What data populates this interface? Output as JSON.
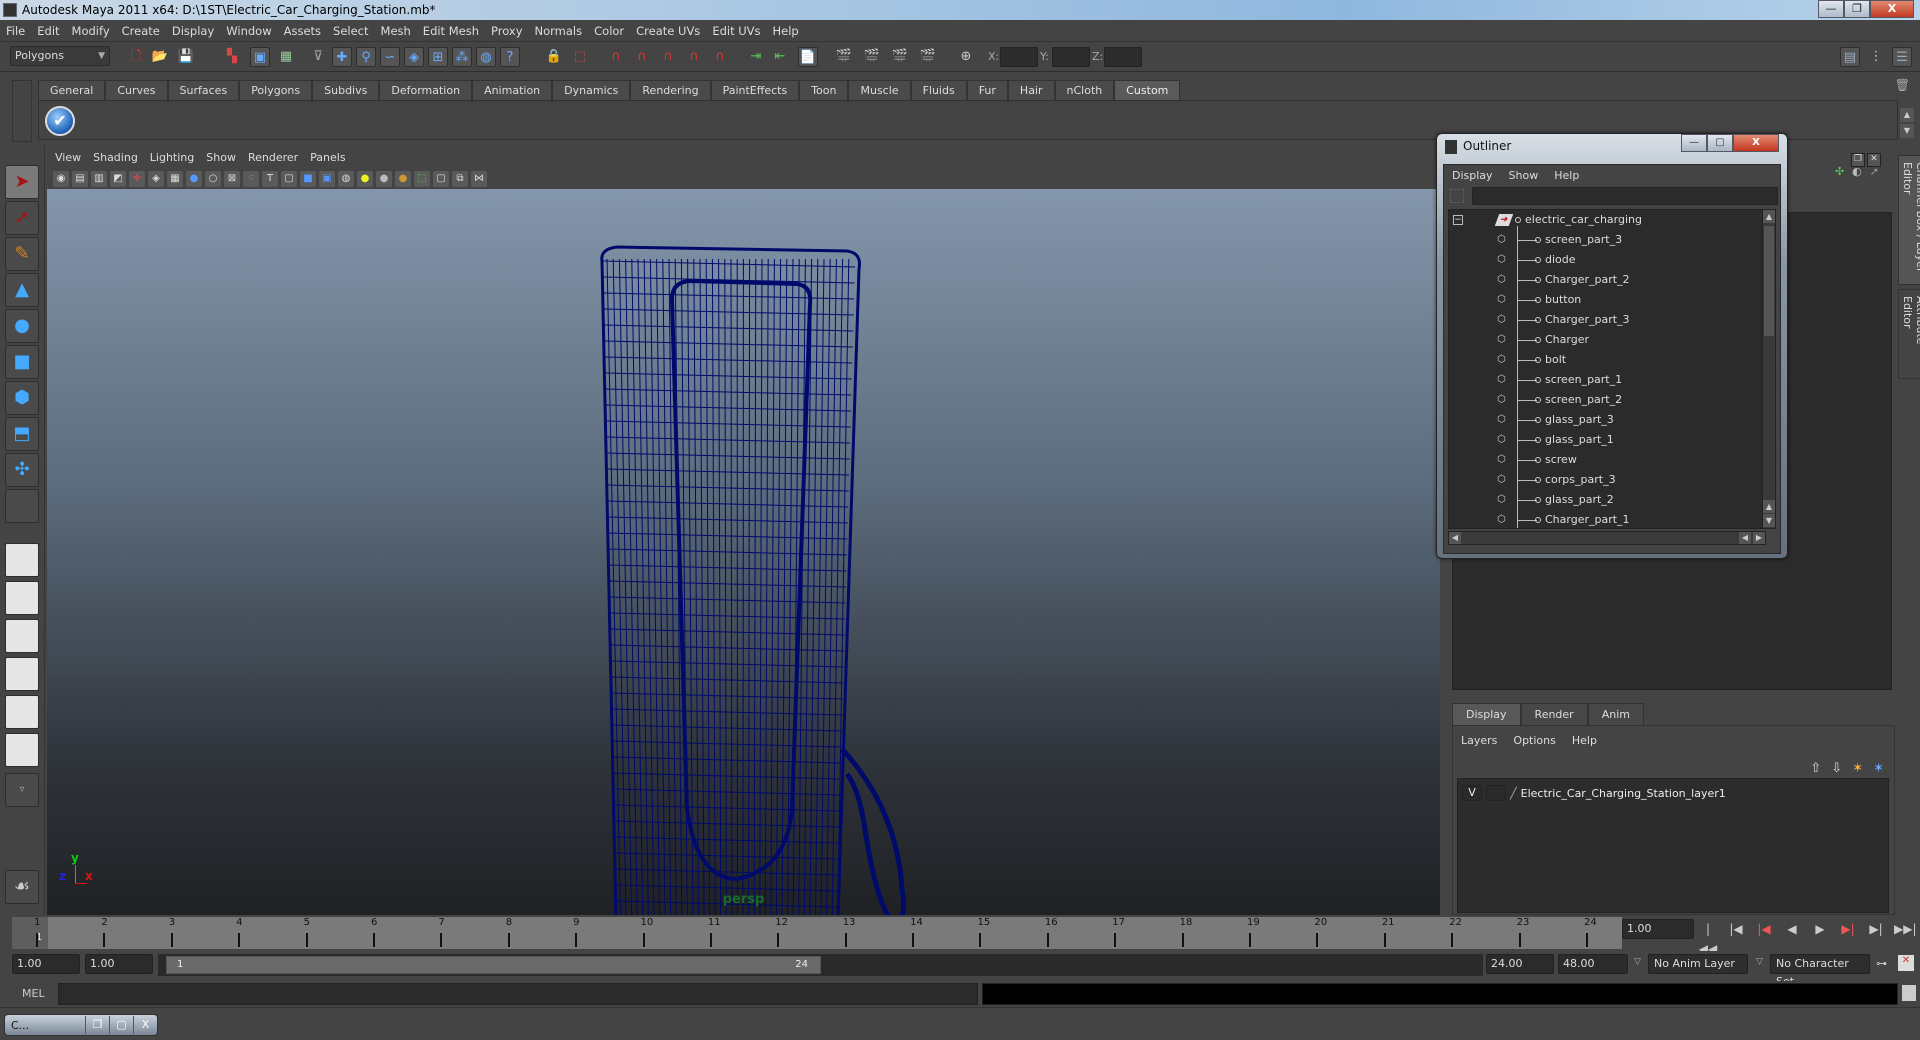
{
  "window": {
    "title": "Autodesk Maya 2011 x64: D:\\1ST\\Electric_Car_Charging_Station.mb*",
    "minimize": "—",
    "restore": "❐",
    "close": "X"
  },
  "menubar": [
    "File",
    "Edit",
    "Modify",
    "Create",
    "Display",
    "Window",
    "Assets",
    "Select",
    "Mesh",
    "Edit Mesh",
    "Proxy",
    "Normals",
    "Color",
    "Create UVs",
    "Edit UVs",
    "Help"
  ],
  "statusline": {
    "mode": "Polygons",
    "x_label": "X:",
    "y_label": "Y:",
    "z_label": "Z:",
    "x_value": "",
    "y_value": "",
    "z_value": ""
  },
  "shelf": {
    "tabs": [
      "General",
      "Curves",
      "Surfaces",
      "Polygons",
      "Subdivs",
      "Deformation",
      "Animation",
      "Dynamics",
      "Rendering",
      "PaintEffects",
      "Toon",
      "Muscle",
      "Fluids",
      "Fur",
      "Hair",
      "nCloth",
      "Custom"
    ],
    "active_tab": "Custom",
    "check_icon": "✔"
  },
  "viewport": {
    "menu": [
      "View",
      "Shading",
      "Lighting",
      "Show",
      "Renderer",
      "Panels"
    ],
    "camera": "persp",
    "axis_x": "x",
    "axis_y": "y",
    "axis_z": "z",
    "wire_color": "#000a6b"
  },
  "outliner": {
    "title": "Outliner",
    "menu": [
      "Display",
      "Show",
      "Help"
    ],
    "root": "electric_car_charging",
    "collapse": "−",
    "items": [
      "screen_part_3",
      "diode",
      "Charger_part_2",
      "button",
      "Charger_part_3",
      "Charger",
      "bolt",
      "screen_part_1",
      "screen_part_2",
      "glass_part_3",
      "glass_part_1",
      "screw",
      "corps_part_3",
      "glass_part_2",
      "Charger_part_1"
    ]
  },
  "rightpanel": {
    "side_tabs": [
      "Channel Box / Layer Editor",
      "Attribute Editor"
    ],
    "layer_tabs": [
      "Display",
      "Render",
      "Anim"
    ],
    "active_layer_tab": "Display",
    "layer_menu": [
      "Layers",
      "Options",
      "Help"
    ],
    "layers": [
      {
        "visible": "V",
        "name": "Electric_Car_Charging_Station_layer1"
      }
    ]
  },
  "timeslider": {
    "ticks": [
      "1",
      "2",
      "3",
      "4",
      "5",
      "6",
      "7",
      "8",
      "9",
      "10",
      "11",
      "12",
      "13",
      "14",
      "15",
      "16",
      "17",
      "18",
      "19",
      "20",
      "21",
      "22",
      "23",
      "24"
    ],
    "current_frame": "1",
    "current_time_field": "1.00",
    "playback": [
      "⏮",
      "|◀",
      "|◀",
      "◀",
      "▶",
      "▶|",
      "▶|",
      "⏭"
    ]
  },
  "rangeslider": {
    "start_time": "1.00",
    "playback_start": "1.00",
    "range_start_label": "1",
    "range_end_label": "24",
    "playback_end": "24.00",
    "end_time": "48.00",
    "anim_layer": "No Anim Layer",
    "character_set": "No Character Set"
  },
  "commandline": {
    "label": "MEL",
    "input": "",
    "result": ""
  },
  "minimized_window": {
    "label": "C..."
  }
}
